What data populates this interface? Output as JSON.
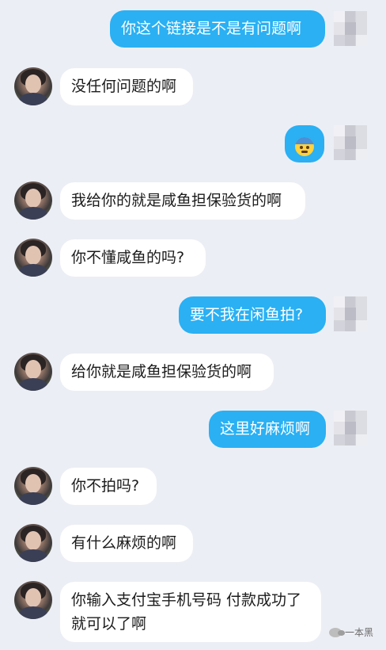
{
  "messages": [
    {
      "side": "right",
      "text": "你这个链接是不是有问题啊"
    },
    {
      "side": "left",
      "text": "没任何问题的啊"
    },
    {
      "side": "right",
      "emoji": "anxious-face-with-sweat"
    },
    {
      "side": "left",
      "text": "我给你的就是咸鱼担保验货的啊"
    },
    {
      "side": "left",
      "text": "你不懂咸鱼的吗?"
    },
    {
      "side": "right",
      "text": "要不我在闲鱼拍?"
    },
    {
      "side": "left",
      "text": "给你就是咸鱼担保验货的啊"
    },
    {
      "side": "right",
      "text": "这里好麻烦啊"
    },
    {
      "side": "left",
      "text": "你不拍吗?"
    },
    {
      "side": "left",
      "text": "有什么麻烦的啊"
    },
    {
      "side": "left",
      "text": "你输入支付宝手机号码 付款成功了就可以了啊"
    }
  ],
  "watermark": {
    "text": "一本黑",
    "icon": "wechat-icon"
  },
  "colors": {
    "background": "#eceef5",
    "bubble_left": "#ffffff",
    "bubble_right": "#2ab0f3"
  }
}
